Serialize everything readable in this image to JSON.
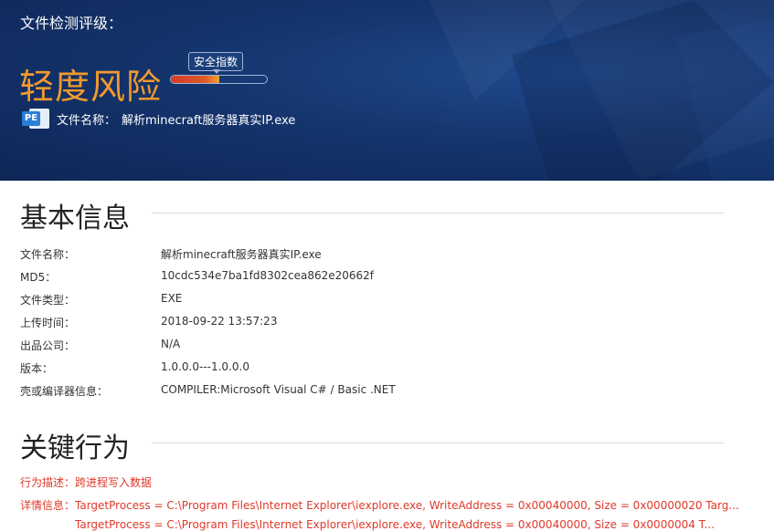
{
  "hero": {
    "label": "文件检测评级：",
    "risk_level": "轻度风险",
    "safety_tooltip": "安全指数",
    "safety_index": 0.5,
    "file_icon": "pe-file-icon",
    "file_icon_text": "PE",
    "file_name_label": "文件名称：",
    "file_name": "解析minecraft服务器真实IP.exe"
  },
  "basic": {
    "title": "基本信息",
    "rows": [
      {
        "key": "文件名称：",
        "value": "解析minecraft服务器真实IP.exe"
      },
      {
        "key": "MD5：",
        "value": "10cdc534e7ba1fd8302cea862e20662f"
      },
      {
        "key": "文件类型：",
        "value": "EXE"
      },
      {
        "key": "上传时间：",
        "value": "2018-09-22 13:57:23"
      },
      {
        "key": "出品公司：",
        "value": "N/A"
      },
      {
        "key": "版本：",
        "value": "1.0.0.0---1.0.0.0"
      },
      {
        "key": "壳或编译器信息：",
        "value": "COMPILER:Microsoft Visual C# / Basic .NET"
      }
    ]
  },
  "behavior": {
    "title": "关键行为",
    "desc": "行为描述：跨进程写入数据",
    "detail": "详情信息：TargetProcess = C:\\Program Files\\Internet Explorer\\iexplore.exe, WriteAddress = 0x00040000, Size = 0x00000020 Targ...",
    "detail_cut": "TargetProcess = C:\\Program Files\\Internet Explorer\\iexplore.exe, WriteAddress = 0x00040000, Size = 0x0000004 T..."
  },
  "colors": {
    "risk": "#f39a2c",
    "behavior": "#e0392a",
    "hero_bg": "#15356e"
  }
}
